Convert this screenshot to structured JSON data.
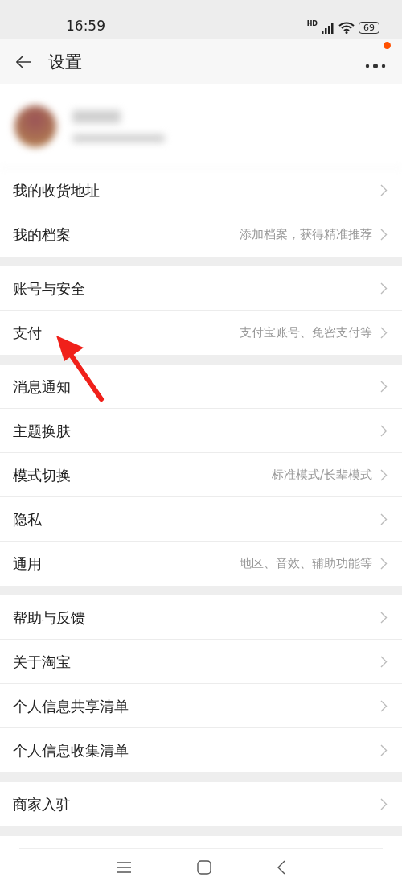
{
  "status_bar": {
    "time": "16:59",
    "network": "HD",
    "battery": "69"
  },
  "header": {
    "title": "设置",
    "menu_badge": true
  },
  "profile": {
    "blurred": true
  },
  "groups": [
    {
      "items": [
        {
          "label": "我的收货地址"
        },
        {
          "label": "我的档案",
          "value": "添加档案，获得精准推荐"
        }
      ]
    },
    {
      "items": [
        {
          "label": "账号与安全"
        },
        {
          "label": "支付",
          "value": "支付宝账号、免密支付等"
        }
      ]
    },
    {
      "items": [
        {
          "label": "消息通知"
        },
        {
          "label": "主题换肤"
        },
        {
          "label": "模式切换",
          "value": "标准模式/长辈模式"
        },
        {
          "label": "隐私"
        },
        {
          "label": "通用",
          "value": "地区、音效、辅助功能等"
        }
      ]
    },
    {
      "items": [
        {
          "label": "帮助与反馈"
        },
        {
          "label": "关于淘宝"
        },
        {
          "label": "个人信息共享清单"
        },
        {
          "label": "个人信息收集清单"
        }
      ]
    },
    {
      "items": [
        {
          "label": "商家入驻"
        }
      ]
    }
  ],
  "annotation": {
    "kind": "arrow"
  }
}
